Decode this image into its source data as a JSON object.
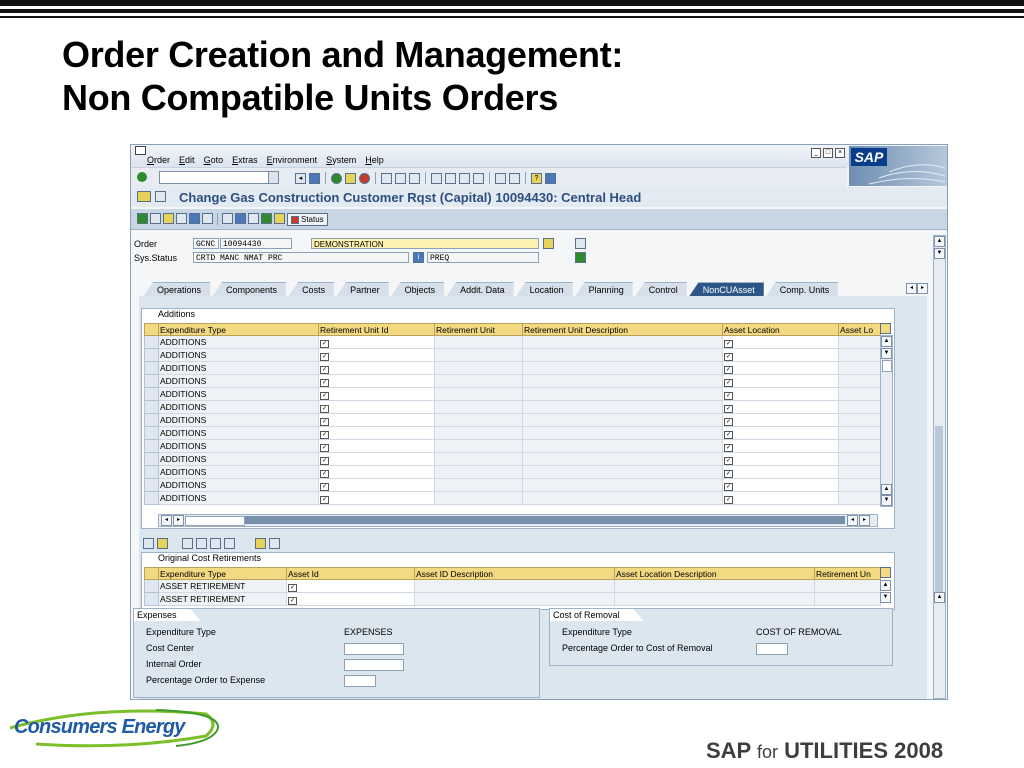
{
  "slide": {
    "title_line1": "Order Creation and Management:",
    "title_line2": "Non Compatible Units Orders",
    "footer_sap": "SAP",
    "footer_for": "for",
    "footer_utilities": "UTILITIES 2008",
    "company_logo_text": "Consumers Energy"
  },
  "sap": {
    "menu": [
      "Order",
      "Edit",
      "Goto",
      "Extras",
      "Environment",
      "System",
      "Help"
    ],
    "logo_text": "SAP",
    "command_field": "",
    "screen_title": "Change Gas Construction Customer Rqst (Capital) 10094430: Central Head",
    "status_button": "Status",
    "order_label": "Order",
    "order_type": "GCNC",
    "order_number": "10094430",
    "order_description": "DEMONSTRATION",
    "sys_status_label": "Sys.Status",
    "sys_status_value": "CRTD MANC NMAT PRC",
    "user_status_value": "PREQ",
    "tabs": [
      "Operations",
      "Components",
      "Costs",
      "Partner",
      "Objects",
      "Addit. Data",
      "Location",
      "Planning",
      "Control",
      "NonCUAsset",
      "Comp. Units"
    ],
    "active_tab": "NonCUAsset",
    "additions": {
      "title": "Additions",
      "columns": [
        "Expenditure Type",
        "Retirement Unit Id",
        "Retirement Unit",
        "Retirement Unit Description",
        "Asset Location",
        "Asset Lo"
      ],
      "rows": [
        "ADDITIONS",
        "ADDITIONS",
        "ADDITIONS",
        "ADDITIONS",
        "ADDITIONS",
        "ADDITIONS",
        "ADDITIONS",
        "ADDITIONS",
        "ADDITIONS",
        "ADDITIONS",
        "ADDITIONS",
        "ADDITIONS",
        "ADDITIONS"
      ]
    },
    "retirements": {
      "title": "Original Cost Retirements",
      "columns": [
        "Expenditure Type",
        "Asset Id",
        "Asset ID Description",
        "Asset Location Description",
        "Retirement Un"
      ],
      "rows": [
        "ASSET RETIREMENT",
        "ASSET RETIREMENT"
      ]
    },
    "expenses": {
      "title": "Expenses",
      "rows": [
        {
          "label": "Expenditure Type",
          "value": "EXPENSES"
        },
        {
          "label": "Cost Center",
          "value": ""
        },
        {
          "label": "Internal Order",
          "value": ""
        },
        {
          "label": "Percentage Order to Expense",
          "value": ""
        }
      ]
    },
    "cost_of_removal": {
      "title": "Cost of Removal",
      "rows": [
        {
          "label": "Expenditure Type",
          "value": "COST OF REMOVAL"
        },
        {
          "label": "Percentage Order to Cost of Removal",
          "value": ""
        }
      ]
    }
  },
  "colors": {
    "screen_title": "#2c4f80",
    "active_tab": "#2d5686",
    "table_header": "#f2d982",
    "logo_blue": "#1f5aa6",
    "logo_green": "#7bbf2a"
  }
}
